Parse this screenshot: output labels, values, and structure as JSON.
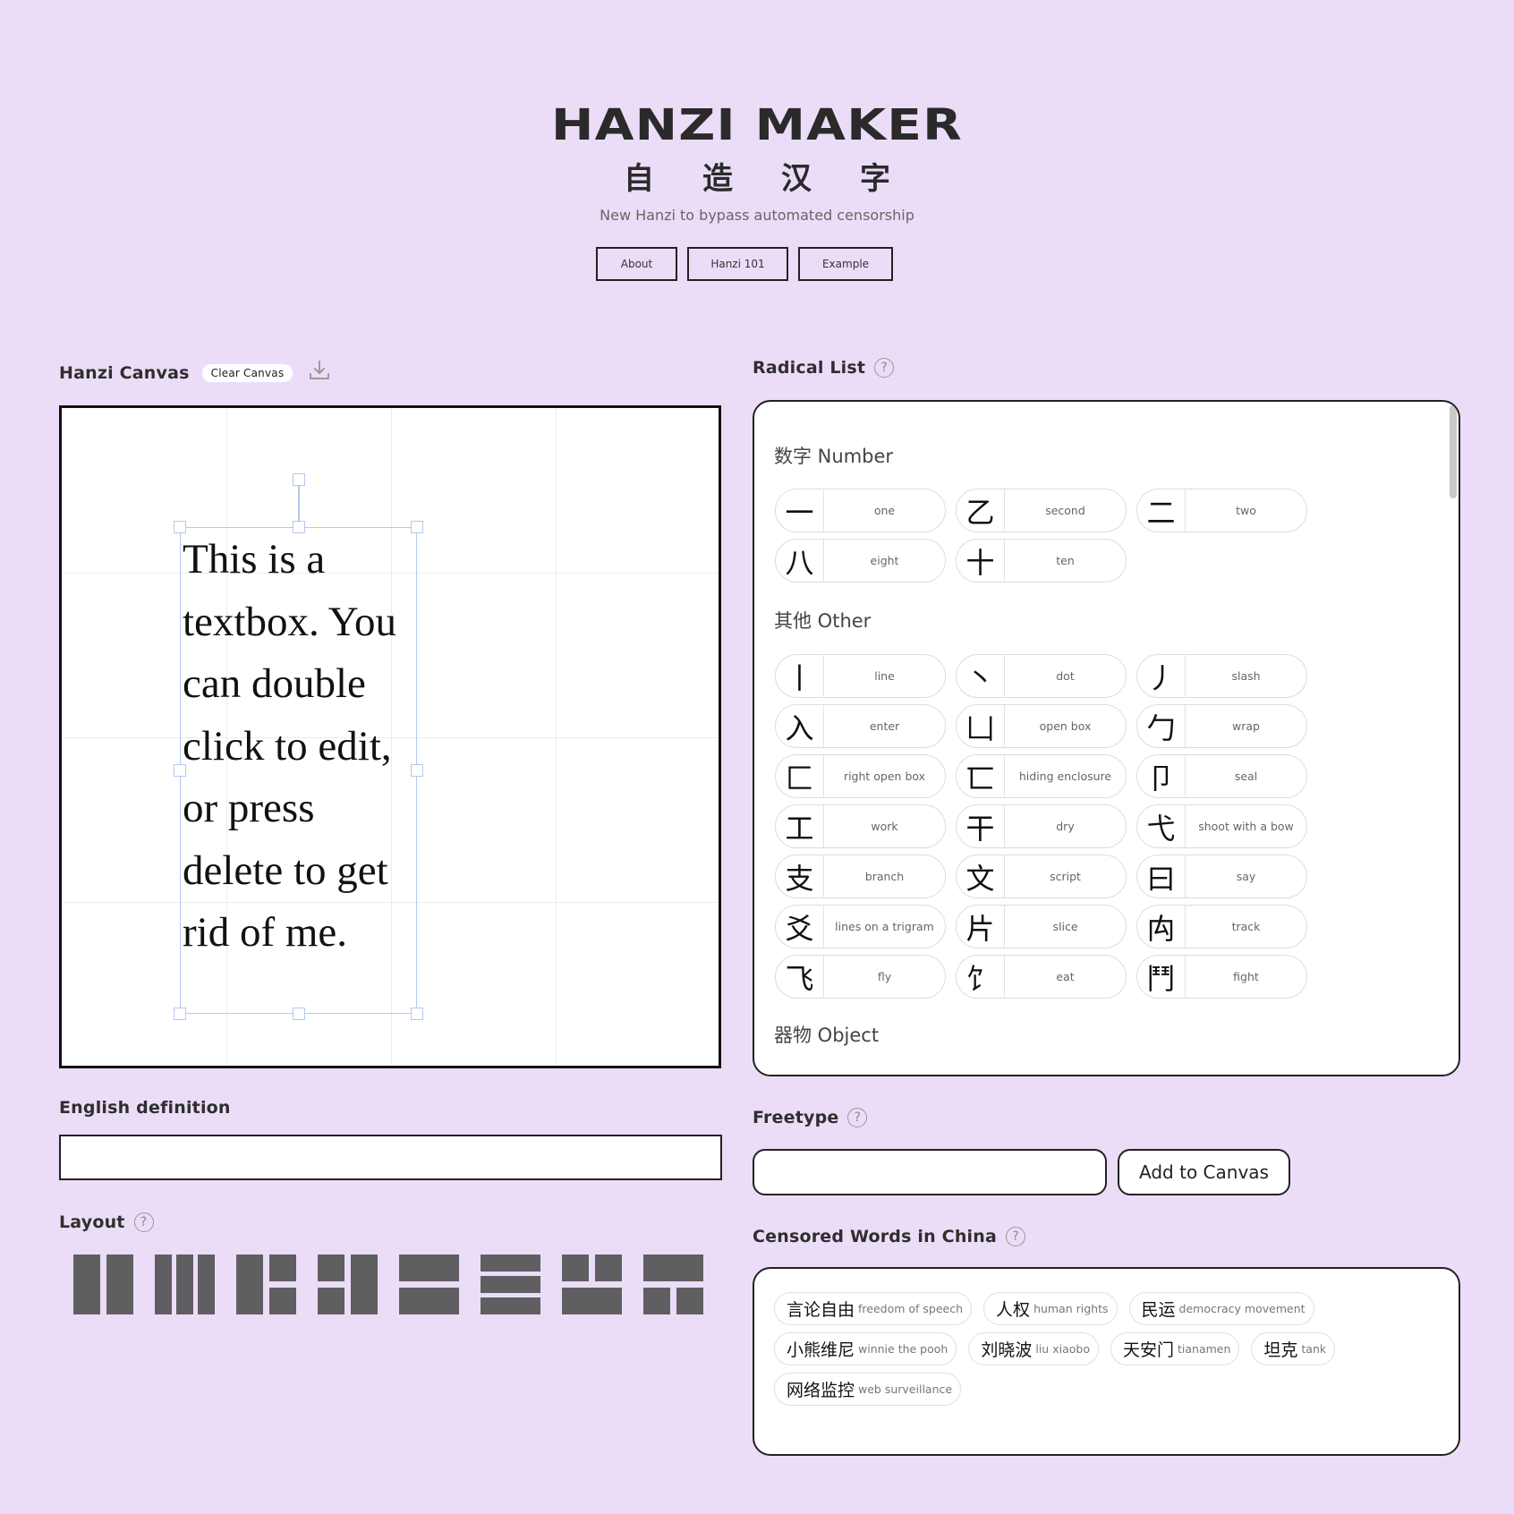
{
  "header": {
    "title": "HANZI MAKER",
    "subtitle_chars": [
      "自",
      "造",
      "汉",
      "字"
    ],
    "tagline": "New Hanzi to bypass automated censorship",
    "nav": [
      {
        "label": "About"
      },
      {
        "label": "Hanzi 101"
      },
      {
        "label": "Example"
      }
    ]
  },
  "canvas_section": {
    "label": "Hanzi Canvas",
    "clear_label": "Clear Canvas",
    "download_icon": "download-icon",
    "textbox_text": "This is a textbox. You can double click to edit, or press delete to get rid of me."
  },
  "definition": {
    "label": "English definition",
    "value": ""
  },
  "layout": {
    "label": "Layout",
    "help": "?",
    "options": [
      "two-columns",
      "three-columns",
      "left-and-split-right",
      "split-left-and-right",
      "two-rows",
      "three-rows",
      "two-top-one-bottom",
      "one-top-two-bottom"
    ]
  },
  "radical_list": {
    "label": "Radical List",
    "help": "?",
    "groups": [
      {
        "title": "数字 Number",
        "items": [
          {
            "ch": "一",
            "en": "one"
          },
          {
            "ch": "乙",
            "en": "second"
          },
          {
            "ch": "二",
            "en": "two"
          },
          {
            "ch": "八",
            "en": "eight"
          },
          {
            "ch": "十",
            "en": "ten"
          }
        ]
      },
      {
        "title": "其他 Other",
        "items": [
          {
            "ch": "丨",
            "en": "line"
          },
          {
            "ch": "丶",
            "en": "dot"
          },
          {
            "ch": "丿",
            "en": "slash"
          },
          {
            "ch": "入",
            "en": "enter"
          },
          {
            "ch": "凵",
            "en": "open box"
          },
          {
            "ch": "勹",
            "en": "wrap"
          },
          {
            "ch": "匚",
            "en": "right open box"
          },
          {
            "ch": "匸",
            "en": "hiding enclosure"
          },
          {
            "ch": "卩",
            "en": "seal"
          },
          {
            "ch": "工",
            "en": "work"
          },
          {
            "ch": "干",
            "en": "dry"
          },
          {
            "ch": "弋",
            "en": "shoot with a bow"
          },
          {
            "ch": "支",
            "en": "branch"
          },
          {
            "ch": "文",
            "en": "script"
          },
          {
            "ch": "曰",
            "en": "say"
          },
          {
            "ch": "爻",
            "en": "lines on a trigram"
          },
          {
            "ch": "片",
            "en": "slice"
          },
          {
            "ch": "禸",
            "en": "track"
          },
          {
            "ch": "飞",
            "en": "fly"
          },
          {
            "ch": "饣",
            "en": "eat"
          },
          {
            "ch": "鬥",
            "en": "fight"
          }
        ]
      },
      {
        "title": "器物 Object",
        "items": []
      }
    ]
  },
  "freetype": {
    "label": "Freetype",
    "help": "?",
    "value": "",
    "button_label": "Add to Canvas"
  },
  "censored": {
    "label": "Censored Words in China",
    "help": "?",
    "words": [
      {
        "zh": "言论自由",
        "en": "freedom of speech"
      },
      {
        "zh": "人权",
        "en": "human rights"
      },
      {
        "zh": "民运",
        "en": "democracy movement"
      },
      {
        "zh": "小熊维尼",
        "en": "winnie the pooh"
      },
      {
        "zh": "刘晓波",
        "en": "liu xiaobo"
      },
      {
        "zh": "天安门",
        "en": "tianamen"
      },
      {
        "zh": "坦克",
        "en": "tank"
      },
      {
        "zh": "网络监控",
        "en": "web surveillance"
      }
    ]
  }
}
